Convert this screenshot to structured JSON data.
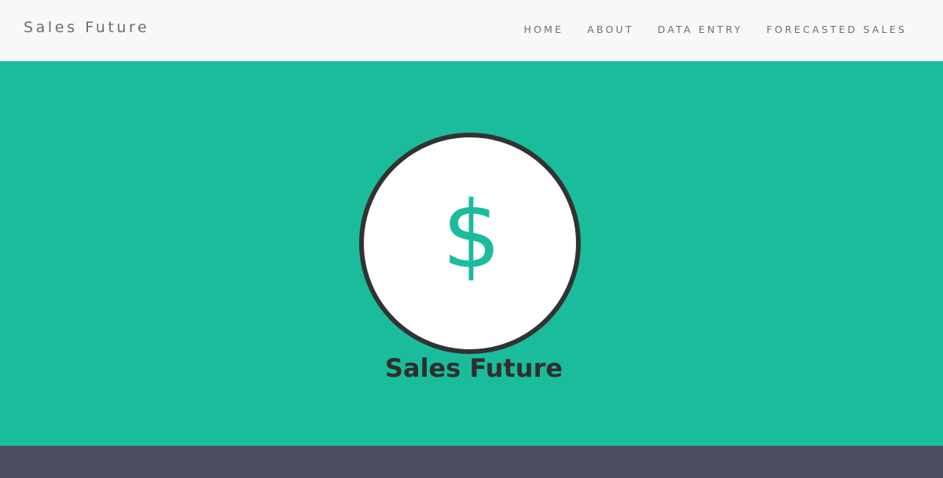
{
  "navbar": {
    "brand": "Sales Future",
    "links": [
      {
        "label": "HOME"
      },
      {
        "label": "ABOUT"
      },
      {
        "label": "DATA ENTRY"
      },
      {
        "label": "FORECASTED SALES"
      }
    ]
  },
  "hero": {
    "logo_icon": "dollar-icon",
    "logo_symbol": "$",
    "title": "Sales Future"
  },
  "colors": {
    "navbar_bg": "#f8f8f9",
    "hero_bg": "#1bbc9b",
    "accent": "#1bbc9b",
    "circle_border": "#323232",
    "footer_bg": "#4a4e5f"
  }
}
